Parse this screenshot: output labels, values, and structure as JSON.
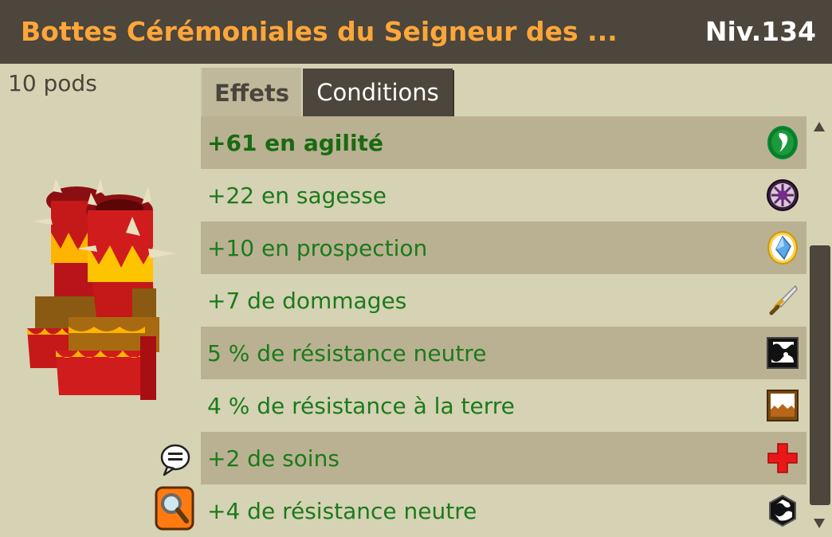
{
  "header": {
    "title": "Bottes Cérémoniales du Seigneur des ...",
    "level": "Niv.134"
  },
  "item": {
    "weight": "10 pods",
    "image_icon": "ceremonial-boots"
  },
  "tabs": [
    {
      "label": "Effets",
      "active": true
    },
    {
      "label": "Conditions",
      "active": false
    }
  ],
  "effects": [
    {
      "text": "+61 en agilité",
      "icon": "agility-icon",
      "highlight": true
    },
    {
      "text": "+22 en sagesse",
      "icon": "wisdom-icon"
    },
    {
      "text": "+10 en prospection",
      "icon": "prospecting-icon"
    },
    {
      "text": "+7 de dommages",
      "icon": "damage-sword-icon"
    },
    {
      "text": "5 % de résistance neutre",
      "icon": "neutral-resistance-icon"
    },
    {
      "text": "4 % de résistance à la terre",
      "icon": "earth-resistance-icon"
    },
    {
      "text": "+2 de soins",
      "icon": "heal-cross-icon"
    },
    {
      "text": "+4 de résistance neutre",
      "icon": "neutral-shield-icon"
    }
  ],
  "colors": {
    "title_bar": "#4c463c",
    "title_text": "#ffa63a",
    "effect_text": "#1b7a1b",
    "row_dark": "#bab192",
    "row_light": "#d6d2b4"
  },
  "scroll": {
    "position": 0.5
  }
}
